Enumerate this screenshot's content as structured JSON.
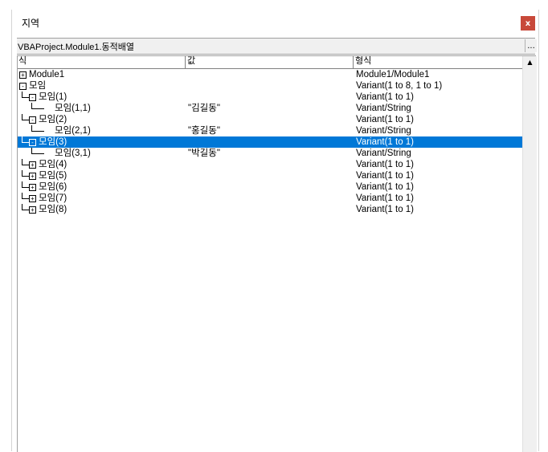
{
  "window": {
    "title": "지역"
  },
  "close_label": "x",
  "context": {
    "text": "VBAProject.Module1.동적배열",
    "button_label": "..."
  },
  "columns": [
    {
      "label": "식"
    },
    {
      "label": "값"
    },
    {
      "label": "형식"
    }
  ],
  "rows": [
    {
      "expander": "+",
      "expanded": false,
      "level": 0,
      "expression": "Module1",
      "value": "",
      "type": "Module1/Module1",
      "selected": false
    },
    {
      "expander": "-",
      "expanded": true,
      "level": 0,
      "expression": "모임",
      "value": "",
      "type": "Variant(1 to 8, 1 to 1)",
      "selected": false
    },
    {
      "expander": "-",
      "expanded": true,
      "level": 1,
      "expression": "모임(1)",
      "value": "",
      "type": "Variant(1 to 1)",
      "selected": false
    },
    {
      "expander": "",
      "expanded": false,
      "level": 2,
      "expression": "모임(1,1)",
      "value": "\"김길동\"",
      "type": "Variant/String",
      "selected": false
    },
    {
      "expander": "-",
      "expanded": true,
      "level": 1,
      "expression": "모임(2)",
      "value": "",
      "type": "Variant(1 to 1)",
      "selected": false
    },
    {
      "expander": "",
      "expanded": false,
      "level": 2,
      "expression": "모임(2,1)",
      "value": "\"홍길동\"",
      "type": "Variant/String",
      "selected": false
    },
    {
      "expander": "-",
      "expanded": true,
      "level": 1,
      "expression": "모임(3)",
      "value": "",
      "type": "Variant(1 to 1)",
      "selected": true
    },
    {
      "expander": "",
      "expanded": false,
      "level": 2,
      "expression": "모임(3,1)",
      "value": "\"박길동\"",
      "type": "Variant/String",
      "selected": false
    },
    {
      "expander": "+",
      "expanded": false,
      "level": 1,
      "expression": "모임(4)",
      "value": "",
      "type": "Variant(1 to 1)",
      "selected": false
    },
    {
      "expander": "+",
      "expanded": false,
      "level": 1,
      "expression": "모임(5)",
      "value": "",
      "type": "Variant(1 to 1)",
      "selected": false
    },
    {
      "expander": "+",
      "expanded": false,
      "level": 1,
      "expression": "모임(6)",
      "value": "",
      "type": "Variant(1 to 1)",
      "selected": false
    },
    {
      "expander": "+",
      "expanded": false,
      "level": 1,
      "expression": "모임(7)",
      "value": "",
      "type": "Variant(1 to 1)",
      "selected": false
    },
    {
      "expander": "+",
      "expanded": false,
      "level": 1,
      "expression": "모임(8)",
      "value": "",
      "type": "Variant(1 to 1)",
      "selected": false
    }
  ],
  "scroll_up_label": "▲",
  "icons": {
    "close": "close-icon",
    "scroll_up": "scroll-up-arrow-icon"
  },
  "colors": {
    "selection": "#0078d7",
    "close": "#c8493a"
  }
}
